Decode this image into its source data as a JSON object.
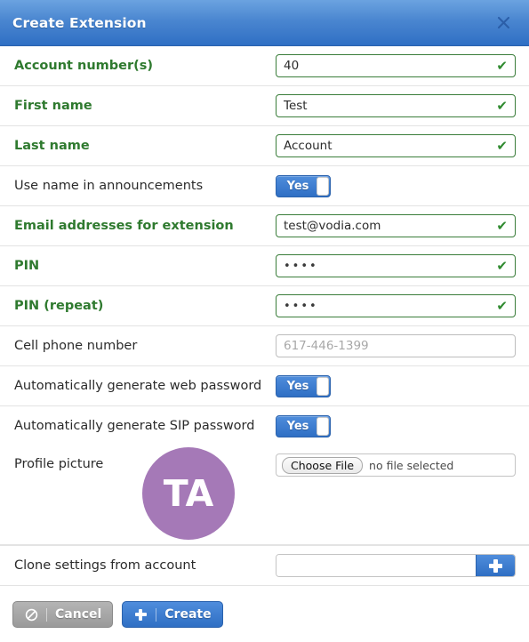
{
  "titlebar": {
    "title": "Create Extension",
    "close_icon": "close-icon"
  },
  "form": {
    "rows": [
      {
        "label": "Account number(s)",
        "label_style": "green",
        "control": "text",
        "value": "40",
        "valid": true
      },
      {
        "label": "First name",
        "label_style": "green",
        "control": "text",
        "value": "Test",
        "valid": true
      },
      {
        "label": "Last name",
        "label_style": "green",
        "control": "text",
        "value": "Account",
        "valid": true
      },
      {
        "label": "Use name in announcements",
        "label_style": "dark",
        "control": "toggle",
        "toggle_label": "Yes"
      },
      {
        "label": "Email addresses for extension",
        "label_style": "green",
        "control": "text",
        "value": "test@vodia.com",
        "valid": true
      },
      {
        "label": "PIN",
        "label_style": "green",
        "control": "password",
        "value": "••••",
        "valid": true
      },
      {
        "label": "PIN (repeat)",
        "label_style": "green",
        "control": "password",
        "value": "••••",
        "valid": true
      },
      {
        "label": "Cell phone number",
        "label_style": "dark",
        "control": "text",
        "value": "",
        "placeholder": "617-446-1399",
        "valid": false
      },
      {
        "label": "Automatically generate web password",
        "label_style": "dark",
        "control": "toggle",
        "toggle_label": "Yes"
      },
      {
        "label": "Automatically generate SIP password",
        "label_style": "dark",
        "control": "toggle",
        "toggle_label": "Yes"
      }
    ],
    "profile_picture": {
      "label": "Profile picture",
      "avatar_initials": "TA",
      "avatar_color": "#a579b7",
      "choose_file_label": "Choose File",
      "no_file_label": "no file selected"
    },
    "clone": {
      "label": "Clone settings from account",
      "value": "",
      "add_icon": "plus-icon"
    }
  },
  "footer": {
    "cancel_label": "Cancel",
    "cancel_icon": "no-entry-icon",
    "create_label": "Create",
    "create_icon": "plus-icon"
  },
  "colors": {
    "accent_blue": "#2f6fc4",
    "valid_green": "#2f7a2f",
    "avatar_purple": "#a579b7"
  }
}
